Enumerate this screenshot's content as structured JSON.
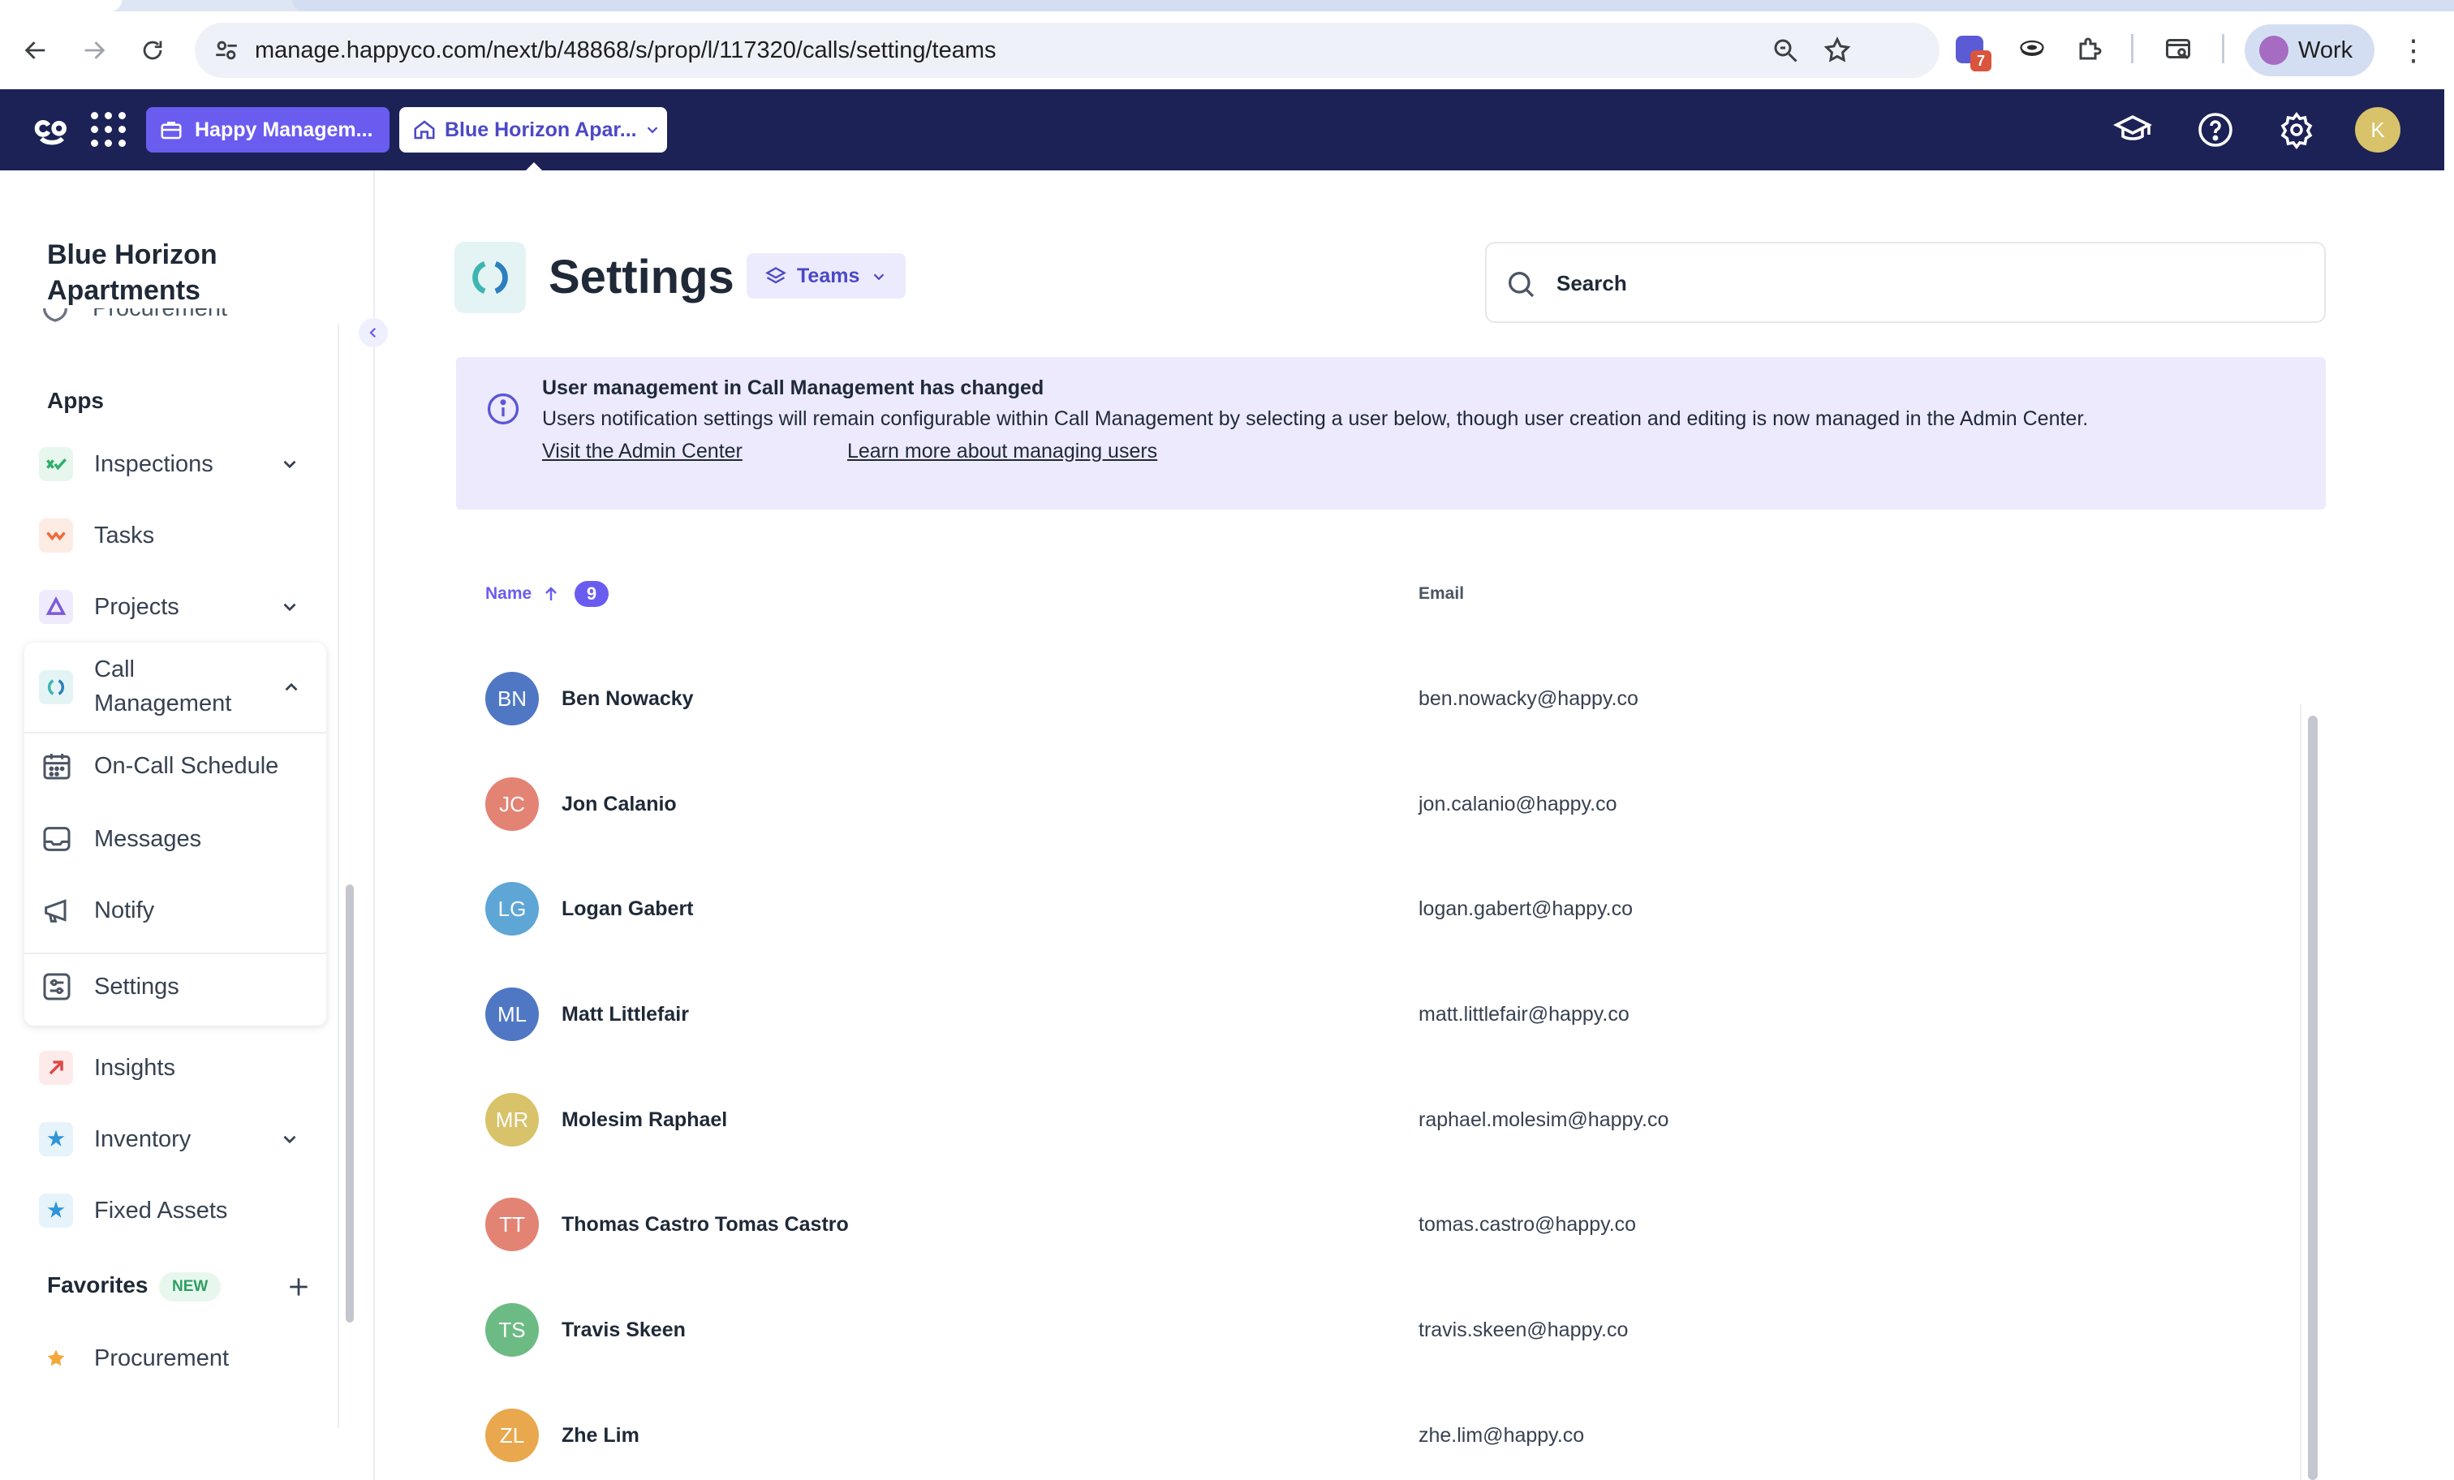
{
  "browser": {
    "url": "manage.happyco.com/next/b/48868/s/prop/l/117320/calls/setting/teams",
    "extension_badge_count": "7",
    "profile_label": "Work"
  },
  "app_bar": {
    "org_label": "Happy Managem...",
    "property_label": "Blue Horizon Apar...",
    "avatar_initial": "K"
  },
  "sidebar": {
    "property_title": "Blue Horizon Apartments",
    "cut_item_label": "Procurement",
    "apps_section": "Apps",
    "items": [
      {
        "label": "Inspections",
        "icon": "inspections-icon",
        "color": "#2fae6b",
        "bg": "#e8f7ee",
        "has_chevron": true
      },
      {
        "label": "Tasks",
        "icon": "tasks-icon",
        "color": "#ef6a3a",
        "bg": "#fdece4",
        "has_chevron": false
      },
      {
        "label": "Projects",
        "icon": "projects-icon",
        "color": "#7a5bd6",
        "bg": "#efeafc",
        "has_chevron": true
      }
    ],
    "call_management": {
      "label": "Call Management",
      "sub_items": [
        {
          "label": "On-Call Schedule",
          "icon": "calendar-icon"
        },
        {
          "label": "Messages",
          "icon": "inbox-icon"
        },
        {
          "label": "Notify",
          "icon": "megaphone-icon"
        },
        {
          "label": "Settings",
          "icon": "sliders-icon"
        }
      ]
    },
    "items_after": [
      {
        "label": "Insights",
        "icon": "insights-icon",
        "color": "#e04848",
        "bg": "#fdeaea",
        "has_chevron": false
      },
      {
        "label": "Inventory",
        "icon": "inventory-icon",
        "color": "#2f95d6",
        "bg": "#e6f3fb",
        "has_chevron": true
      },
      {
        "label": "Fixed Assets",
        "icon": "fixed-assets-icon",
        "color": "#2f95d6",
        "bg": "#e6f3fb",
        "has_chevron": false
      }
    ],
    "favorites_title": "Favorites",
    "favorites_badge": "NEW",
    "favorites": [
      {
        "label": "Procurement",
        "icon": "star-icon",
        "color": "#f2a93b"
      }
    ]
  },
  "page": {
    "title": "Settings",
    "teams_label": "Teams",
    "search_placeholder": "Search"
  },
  "banner": {
    "title": "User management in Call Management has changed",
    "text": "Users notification settings will remain configurable within Call Management by selecting a user below, though user creation and editing is now managed in the Admin Center.",
    "link_admin": "Visit the Admin Center",
    "link_learn": "Learn more about managing users"
  },
  "table": {
    "col_name": "Name",
    "count": "9",
    "col_email": "Email",
    "rows": [
      {
        "initials": "BN",
        "name": "Ben Nowacky",
        "email": "ben.nowacky@happy.co",
        "color": "#4f77c4"
      },
      {
        "initials": "JC",
        "name": "Jon Calanio",
        "email": "jon.calanio@happy.co",
        "color": "#e38374"
      },
      {
        "initials": "LG",
        "name": "Logan Gabert",
        "email": "logan.gabert@happy.co",
        "color": "#5ea6d6"
      },
      {
        "initials": "ML",
        "name": "Matt Littlefair",
        "email": "matt.littlefair@happy.co",
        "color": "#4f77c4"
      },
      {
        "initials": "MR",
        "name": "Molesim Raphael",
        "email": "raphael.molesim@happy.co",
        "color": "#d8c26a"
      },
      {
        "initials": "TT",
        "name": "Thomas Castro Tomas Castro",
        "email": "tomas.castro@happy.co",
        "color": "#e38374"
      },
      {
        "initials": "TS",
        "name": "Travis Skeen",
        "email": "travis.skeen@happy.co",
        "color": "#6dbb84"
      },
      {
        "initials": "ZL",
        "name": "Zhe Lim",
        "email": "zhe.lim@happy.co",
        "color": "#eaa84e"
      }
    ]
  }
}
